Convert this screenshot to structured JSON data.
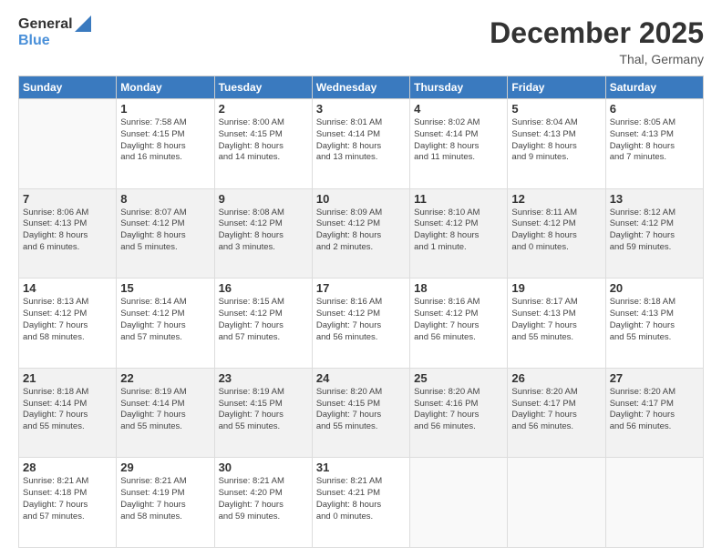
{
  "header": {
    "logo_general": "General",
    "logo_blue": "Blue",
    "month_title": "December 2025",
    "subtitle": "Thal, Germany"
  },
  "days_of_week": [
    "Sunday",
    "Monday",
    "Tuesday",
    "Wednesday",
    "Thursday",
    "Friday",
    "Saturday"
  ],
  "weeks": [
    [
      {
        "day": "",
        "lines": []
      },
      {
        "day": "1",
        "lines": [
          "Sunrise: 7:58 AM",
          "Sunset: 4:15 PM",
          "Daylight: 8 hours",
          "and 16 minutes."
        ]
      },
      {
        "day": "2",
        "lines": [
          "Sunrise: 8:00 AM",
          "Sunset: 4:15 PM",
          "Daylight: 8 hours",
          "and 14 minutes."
        ]
      },
      {
        "day": "3",
        "lines": [
          "Sunrise: 8:01 AM",
          "Sunset: 4:14 PM",
          "Daylight: 8 hours",
          "and 13 minutes."
        ]
      },
      {
        "day": "4",
        "lines": [
          "Sunrise: 8:02 AM",
          "Sunset: 4:14 PM",
          "Daylight: 8 hours",
          "and 11 minutes."
        ]
      },
      {
        "day": "5",
        "lines": [
          "Sunrise: 8:04 AM",
          "Sunset: 4:13 PM",
          "Daylight: 8 hours",
          "and 9 minutes."
        ]
      },
      {
        "day": "6",
        "lines": [
          "Sunrise: 8:05 AM",
          "Sunset: 4:13 PM",
          "Daylight: 8 hours",
          "and 7 minutes."
        ]
      }
    ],
    [
      {
        "day": "7",
        "lines": [
          "Sunrise: 8:06 AM",
          "Sunset: 4:13 PM",
          "Daylight: 8 hours",
          "and 6 minutes."
        ]
      },
      {
        "day": "8",
        "lines": [
          "Sunrise: 8:07 AM",
          "Sunset: 4:12 PM",
          "Daylight: 8 hours",
          "and 5 minutes."
        ]
      },
      {
        "day": "9",
        "lines": [
          "Sunrise: 8:08 AM",
          "Sunset: 4:12 PM",
          "Daylight: 8 hours",
          "and 3 minutes."
        ]
      },
      {
        "day": "10",
        "lines": [
          "Sunrise: 8:09 AM",
          "Sunset: 4:12 PM",
          "Daylight: 8 hours",
          "and 2 minutes."
        ]
      },
      {
        "day": "11",
        "lines": [
          "Sunrise: 8:10 AM",
          "Sunset: 4:12 PM",
          "Daylight: 8 hours",
          "and 1 minute."
        ]
      },
      {
        "day": "12",
        "lines": [
          "Sunrise: 8:11 AM",
          "Sunset: 4:12 PM",
          "Daylight: 8 hours",
          "and 0 minutes."
        ]
      },
      {
        "day": "13",
        "lines": [
          "Sunrise: 8:12 AM",
          "Sunset: 4:12 PM",
          "Daylight: 7 hours",
          "and 59 minutes."
        ]
      }
    ],
    [
      {
        "day": "14",
        "lines": [
          "Sunrise: 8:13 AM",
          "Sunset: 4:12 PM",
          "Daylight: 7 hours",
          "and 58 minutes."
        ]
      },
      {
        "day": "15",
        "lines": [
          "Sunrise: 8:14 AM",
          "Sunset: 4:12 PM",
          "Daylight: 7 hours",
          "and 57 minutes."
        ]
      },
      {
        "day": "16",
        "lines": [
          "Sunrise: 8:15 AM",
          "Sunset: 4:12 PM",
          "Daylight: 7 hours",
          "and 57 minutes."
        ]
      },
      {
        "day": "17",
        "lines": [
          "Sunrise: 8:16 AM",
          "Sunset: 4:12 PM",
          "Daylight: 7 hours",
          "and 56 minutes."
        ]
      },
      {
        "day": "18",
        "lines": [
          "Sunrise: 8:16 AM",
          "Sunset: 4:12 PM",
          "Daylight: 7 hours",
          "and 56 minutes."
        ]
      },
      {
        "day": "19",
        "lines": [
          "Sunrise: 8:17 AM",
          "Sunset: 4:13 PM",
          "Daylight: 7 hours",
          "and 55 minutes."
        ]
      },
      {
        "day": "20",
        "lines": [
          "Sunrise: 8:18 AM",
          "Sunset: 4:13 PM",
          "Daylight: 7 hours",
          "and 55 minutes."
        ]
      }
    ],
    [
      {
        "day": "21",
        "lines": [
          "Sunrise: 8:18 AM",
          "Sunset: 4:14 PM",
          "Daylight: 7 hours",
          "and 55 minutes."
        ]
      },
      {
        "day": "22",
        "lines": [
          "Sunrise: 8:19 AM",
          "Sunset: 4:14 PM",
          "Daylight: 7 hours",
          "and 55 minutes."
        ]
      },
      {
        "day": "23",
        "lines": [
          "Sunrise: 8:19 AM",
          "Sunset: 4:15 PM",
          "Daylight: 7 hours",
          "and 55 minutes."
        ]
      },
      {
        "day": "24",
        "lines": [
          "Sunrise: 8:20 AM",
          "Sunset: 4:15 PM",
          "Daylight: 7 hours",
          "and 55 minutes."
        ]
      },
      {
        "day": "25",
        "lines": [
          "Sunrise: 8:20 AM",
          "Sunset: 4:16 PM",
          "Daylight: 7 hours",
          "and 56 minutes."
        ]
      },
      {
        "day": "26",
        "lines": [
          "Sunrise: 8:20 AM",
          "Sunset: 4:17 PM",
          "Daylight: 7 hours",
          "and 56 minutes."
        ]
      },
      {
        "day": "27",
        "lines": [
          "Sunrise: 8:20 AM",
          "Sunset: 4:17 PM",
          "Daylight: 7 hours",
          "and 56 minutes."
        ]
      }
    ],
    [
      {
        "day": "28",
        "lines": [
          "Sunrise: 8:21 AM",
          "Sunset: 4:18 PM",
          "Daylight: 7 hours",
          "and 57 minutes."
        ]
      },
      {
        "day": "29",
        "lines": [
          "Sunrise: 8:21 AM",
          "Sunset: 4:19 PM",
          "Daylight: 7 hours",
          "and 58 minutes."
        ]
      },
      {
        "day": "30",
        "lines": [
          "Sunrise: 8:21 AM",
          "Sunset: 4:20 PM",
          "Daylight: 7 hours",
          "and 59 minutes."
        ]
      },
      {
        "day": "31",
        "lines": [
          "Sunrise: 8:21 AM",
          "Sunset: 4:21 PM",
          "Daylight: 8 hours",
          "and 0 minutes."
        ]
      },
      {
        "day": "",
        "lines": []
      },
      {
        "day": "",
        "lines": []
      },
      {
        "day": "",
        "lines": []
      }
    ]
  ]
}
